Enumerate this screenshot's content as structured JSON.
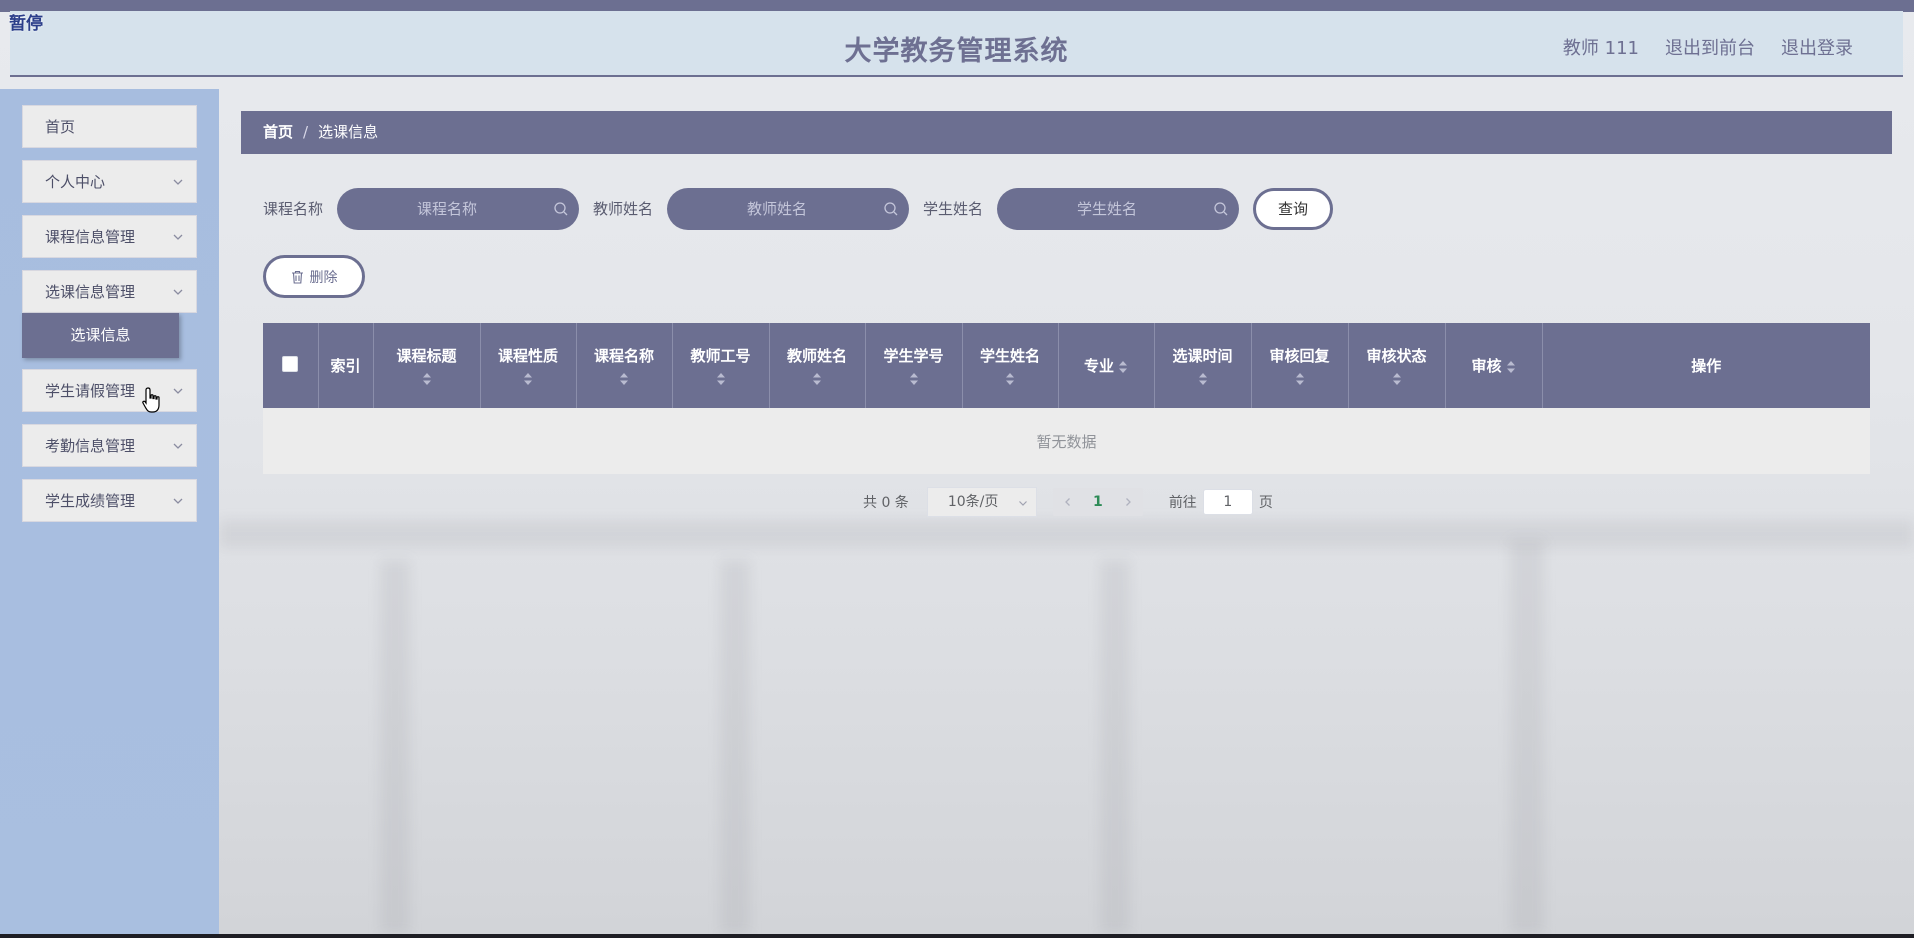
{
  "overlay": {
    "pause_label": "暂停"
  },
  "header": {
    "title": "大学教务管理系统",
    "user": "教师 111",
    "to_frontend": "退出到前台",
    "logout": "退出登录"
  },
  "sidebar": {
    "items": [
      {
        "label": "首页"
      },
      {
        "label": "个人中心"
      },
      {
        "label": "课程信息管理"
      },
      {
        "label": "选课信息管理"
      },
      {
        "label": "学生请假管理"
      },
      {
        "label": "考勤信息管理"
      },
      {
        "label": "学生成绩管理"
      }
    ],
    "active_sub": "选课信息"
  },
  "breadcrumb": {
    "home": "首页",
    "separator": "/",
    "current": "选课信息"
  },
  "search": {
    "course_label": "课程名称",
    "course_placeholder": "课程名称",
    "teacher_label": "教师姓名",
    "teacher_placeholder": "教师姓名",
    "student_label": "学生姓名",
    "student_placeholder": "学生姓名",
    "query_button": "查询"
  },
  "actions": {
    "delete_button": "删除"
  },
  "table": {
    "columns": {
      "index": "索引",
      "course_title": "课程标题",
      "course_nature": "课程性质",
      "course_name": "课程名称",
      "teacher_id": "教师工号",
      "teacher_name": "教师姓名",
      "student_id": "学生学号",
      "student_name": "学生姓名",
      "major": "专业",
      "select_time": "选课时间",
      "review_reply": "审核回复",
      "review_status": "审核状态",
      "review": "审核",
      "operation": "操作"
    },
    "empty_text": "暂无数据"
  },
  "pagination": {
    "total": "共 0 条",
    "page_size": "10条/页",
    "current_page": "1",
    "goto_label": "前往",
    "goto_value": "1",
    "page_unit": "页"
  },
  "colors": {
    "primary": "#6c6f91",
    "sidebar_bg": "#a7bddf",
    "header_bg": "#d6e2ec",
    "active_page": "#2e8b57"
  }
}
